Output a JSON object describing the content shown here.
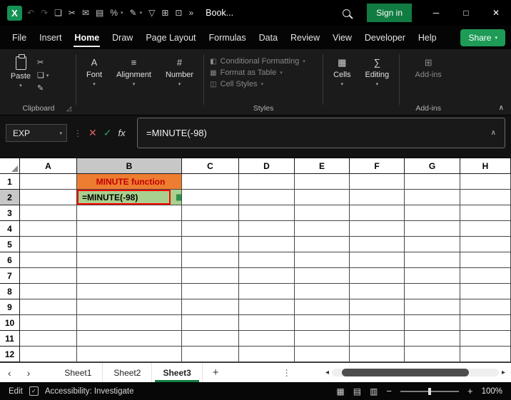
{
  "icons": {
    "chevron_down": "▾",
    "chevron_up": "∧",
    "overflow": "»",
    "dots_vertical": "⋮",
    "nav_left": "‹",
    "nav_right": "›",
    "scroll_left": "◂",
    "scroll_right": "▸",
    "minimize": "─",
    "maximize": "□",
    "close": "✕",
    "zoom_out": "−",
    "zoom_in": "+",
    "dialog_launcher": "◿",
    "accessibility_check": "✓"
  },
  "colors": {
    "accent_green": "#107C41",
    "share_green": "#1d9b57",
    "cell_b1_bg": "#ED7D31",
    "cell_b1_text": "#C00000",
    "cell_b2_bg": "#A9D08E",
    "selection_border_red": "#FF0000"
  },
  "titlebar": {
    "app_icon_letter": "X",
    "workbook_name": "Book...",
    "signin_label": "Sign in",
    "quick_access_icons": [
      {
        "name": "undo-icon",
        "glyph": "↶",
        "disabled": true
      },
      {
        "name": "redo-icon",
        "glyph": "↷",
        "disabled": true
      },
      {
        "name": "copy-icon",
        "glyph": "❏"
      },
      {
        "name": "cut-icon",
        "glyph": "✂"
      },
      {
        "name": "mail-icon",
        "glyph": "✉"
      },
      {
        "name": "print-icon",
        "glyph": "▤"
      },
      {
        "name": "percent-style-icon",
        "glyph": "%",
        "chevron": true
      },
      {
        "name": "format-painter-icon",
        "glyph": "✎",
        "chevron": true
      },
      {
        "name": "filter-icon",
        "glyph": "▽"
      },
      {
        "name": "table-icon",
        "glyph": "⊞"
      },
      {
        "name": "camera-icon",
        "glyph": "⊡"
      }
    ]
  },
  "menubar": {
    "items": [
      "File",
      "Insert",
      "Home",
      "Draw",
      "Page Layout",
      "Formulas",
      "Data",
      "Review",
      "View",
      "Developer",
      "Help"
    ],
    "active": "Home",
    "share_label": "Share"
  },
  "ribbon": {
    "paste": {
      "label": "Paste"
    },
    "clipboard_icons": [
      {
        "name": "cut-icon",
        "glyph": "✂"
      },
      {
        "name": "copy-icon",
        "glyph": "❏",
        "chevron": true
      },
      {
        "name": "format-painter-icon",
        "glyph": "✎"
      }
    ],
    "clipboard_group_label": "Clipboard",
    "font": {
      "label": "Font",
      "icon": "A"
    },
    "alignment": {
      "label": "Alignment",
      "icon": "≡"
    },
    "number": {
      "label": "Number",
      "icon": "#"
    },
    "styles_items": [
      {
        "name": "conditional-formatting",
        "label": "Conditional Formatting",
        "icon": "◧"
      },
      {
        "name": "format-as-table",
        "label": "Format as Table",
        "icon": "▦"
      },
      {
        "name": "cell-styles",
        "label": "Cell Styles",
        "icon": "◫"
      }
    ],
    "styles_group_label": "Styles",
    "cells": {
      "label": "Cells",
      "icon": "▦"
    },
    "editing": {
      "label": "Editing",
      "icon": "∑"
    },
    "addins": {
      "label": "Add-ins",
      "icon": "⊞"
    },
    "addins_group_label": "Add-ins"
  },
  "formula_bar": {
    "name_box": "EXP",
    "cancel_icon": "✕",
    "enter_icon": "✓",
    "fx_label": "fx",
    "formula": "=MINUTE(-98)"
  },
  "grid": {
    "columns": [
      "A",
      "B",
      "C",
      "D",
      "E",
      "F",
      "G",
      "H"
    ],
    "rows": [
      1,
      2,
      3,
      4,
      5,
      6,
      7,
      8,
      9,
      10,
      11,
      12
    ],
    "selected_column": "B",
    "selected_row": 2,
    "cells": [
      {
        "ref": "B1",
        "text": "MINUTE function",
        "bg": "#ED7D31",
        "color": "#C00000",
        "bold": true,
        "align": "center"
      },
      {
        "ref": "B2",
        "text": "=MINUTE(-98)",
        "bg": "#A9D08E",
        "color": "#000000",
        "bold": true,
        "red_border": true
      }
    ]
  },
  "sheet_tabs": {
    "tabs": [
      "Sheet1",
      "Sheet2",
      "Sheet3"
    ],
    "active": "Sheet3",
    "add_label": "+"
  },
  "status_bar": {
    "mode": "Edit",
    "accessibility": "Accessibility: Investigate",
    "zoom_level": "100%",
    "view_icons": [
      {
        "name": "normal-view-icon",
        "glyph": "▦"
      },
      {
        "name": "page-layout-icon",
        "glyph": "▤"
      },
      {
        "name": "page-break-preview-icon",
        "glyph": "▥"
      }
    ]
  }
}
